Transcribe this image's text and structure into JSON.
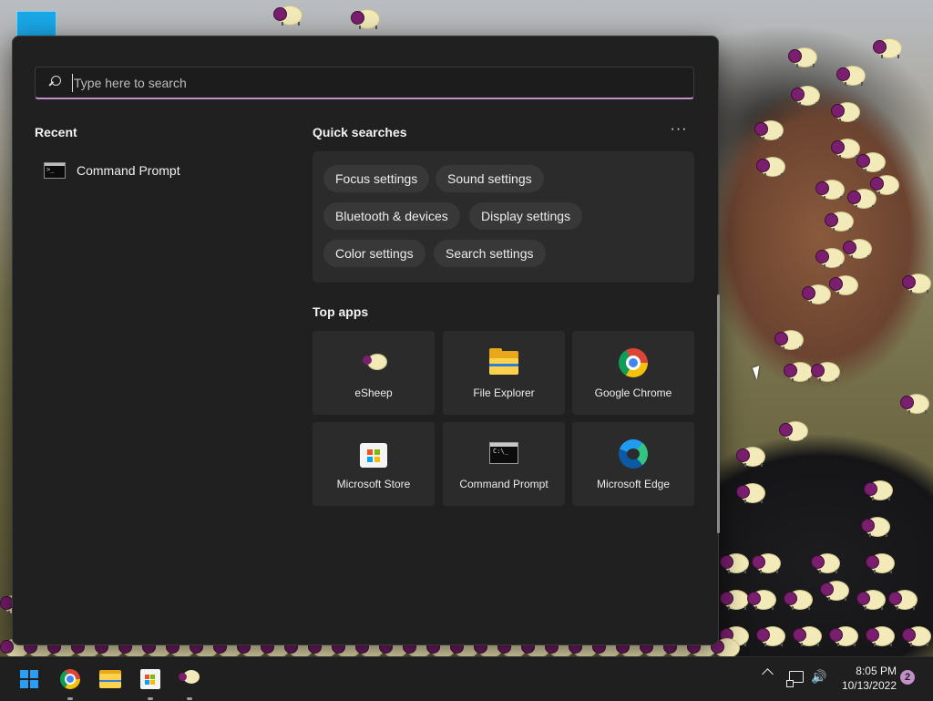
{
  "start_menu": {
    "search": {
      "placeholder": "Type here to search",
      "value": ""
    },
    "recent": {
      "title": "Recent",
      "items": [
        {
          "label": "Command Prompt",
          "icon": "command-prompt-icon"
        }
      ]
    },
    "quick_searches": {
      "title": "Quick searches",
      "more_label": "···",
      "chips": [
        "Focus settings",
        "Sound settings",
        "Bluetooth & devices",
        "Display settings",
        "Color settings",
        "Search settings"
      ]
    },
    "top_apps": {
      "title": "Top apps",
      "apps": [
        {
          "label": "eSheep",
          "icon": "esheep-icon"
        },
        {
          "label": "File Explorer",
          "icon": "file-explorer-icon"
        },
        {
          "label": "Google Chrome",
          "icon": "chrome-icon"
        },
        {
          "label": "Microsoft Store",
          "icon": "microsoft-store-icon"
        },
        {
          "label": "Command Prompt",
          "icon": "command-prompt-icon"
        },
        {
          "label": "Microsoft Edge",
          "icon": "edge-icon"
        }
      ]
    }
  },
  "taskbar": {
    "pinned": [
      {
        "name": "start",
        "icon": "windows-logo-icon"
      },
      {
        "name": "chrome",
        "icon": "chrome-icon"
      },
      {
        "name": "file-explorer",
        "icon": "folder-icon"
      },
      {
        "name": "microsoft-store",
        "icon": "store-icon"
      },
      {
        "name": "esheep",
        "icon": "sheep-icon"
      }
    ],
    "tray": {
      "time": "8:05 PM",
      "date": "10/13/2022",
      "notification_count": "2"
    }
  },
  "colors": {
    "accent": "#c28fc7",
    "panel_bg": "#202020",
    "tile_bg": "#2b2b2b",
    "chip_bg": "#383838",
    "taskbar_bg": "#1f1f1f",
    "windows_blue": "#2b9ef3"
  }
}
